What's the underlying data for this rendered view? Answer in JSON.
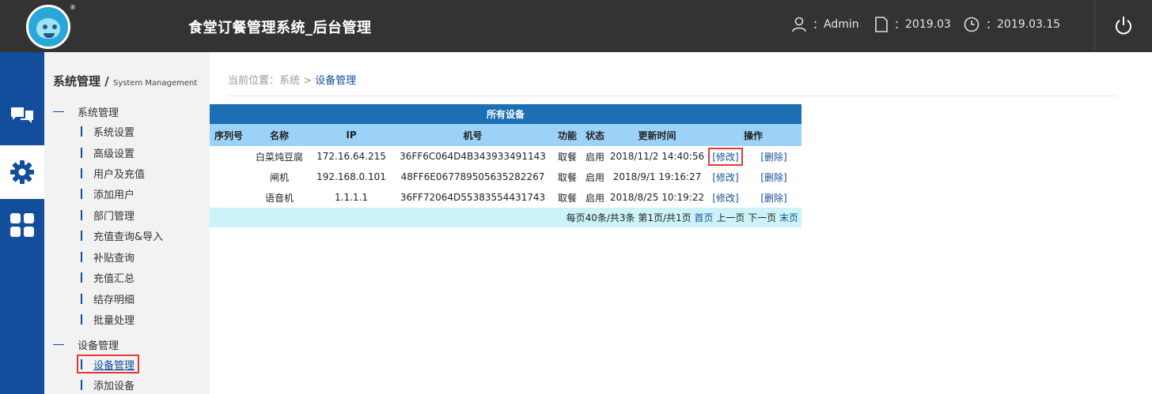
{
  "header": {
    "title": "食堂订餐管理系统_后台管理",
    "user": "Admin",
    "month": "2019.03",
    "date": "2019.03.15",
    "sep": "："
  },
  "sidebar": {
    "title": "系统管理 / ",
    "title_en": "System Management",
    "groups": [
      {
        "label": "系统管理",
        "items": [
          "系统设置",
          "高级设置",
          "用户及充值",
          "添加用户",
          "部门管理",
          "充值查询&导入",
          "补贴查询",
          "充值汇总",
          "结存明细",
          "批量处理"
        ]
      },
      {
        "label": "设备管理",
        "items": [
          "设备管理",
          "添加设备"
        ]
      }
    ]
  },
  "breadcrumb": {
    "prefix": "当前位置：系统 > ",
    "current": "设备管理"
  },
  "table": {
    "caption": "所有设备",
    "headers": [
      "序列号",
      "名称",
      "IP",
      "机号",
      "功能",
      "状态",
      "更新时间",
      "操作"
    ],
    "rows": [
      {
        "seq": "",
        "name": "白菜炖豆腐",
        "ip": "172.16.64.215",
        "machine": "36FF6C064D4B343933491143",
        "func": "取餐",
        "status": "启用",
        "updated": "2018/11/2 14:40:56"
      },
      {
        "seq": "",
        "name": "闸机",
        "ip": "192.168.0.101",
        "machine": "48FF6E067789505635282267",
        "func": "取餐",
        "status": "启用",
        "updated": "2018/9/1 19:16:27"
      },
      {
        "seq": "",
        "name": "语音机",
        "ip": "1.1.1.1",
        "machine": "36FF72064D55383554431743",
        "func": "取餐",
        "status": "启用",
        "updated": "2018/8/25 10:19:22"
      }
    ],
    "edit_label": "[修改]",
    "delete_label": "[删除]",
    "pager": {
      "summary": "每页40条/共3条 第1页/共1页 ",
      "first": "首页",
      "prev": " 上一页 ",
      "next": "下一页 ",
      "last": "末页"
    }
  },
  "colors": {
    "topbar": "#333333",
    "rail": "#124e9b",
    "header_row": "#9cd2f7",
    "caption": "#1a6fb5",
    "pager": "#ccf4f8",
    "highlight": "#e53935"
  },
  "icons": [
    "user-icon",
    "document-icon",
    "clock-icon",
    "power-icon",
    "chat-icon",
    "gear-icon",
    "grid-icon"
  ]
}
